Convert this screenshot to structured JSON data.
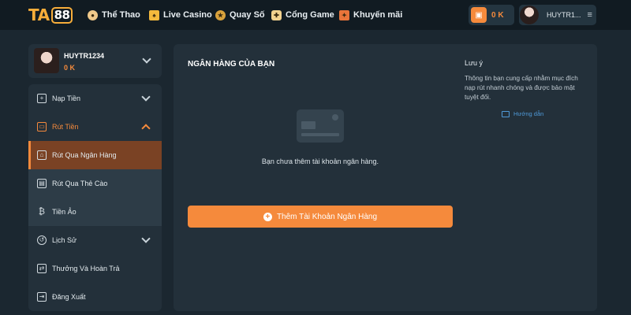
{
  "header": {
    "logo_text": "TA",
    "logo_badge": "88",
    "nav": [
      {
        "label": "Thể Thao",
        "icon": "ball-icon"
      },
      {
        "label": "Live Casino",
        "icon": "cards-icon"
      },
      {
        "label": "Quay Số",
        "icon": "lottery-icon"
      },
      {
        "label": "Cổng Game",
        "icon": "gamepad-icon"
      },
      {
        "label": "Khuyến mãi",
        "icon": "gift-icon"
      }
    ],
    "balance": "0 K",
    "username": "HUYTR1...",
    "menu_glyph": "≡"
  },
  "sidebar": {
    "profile": {
      "name": "HUYTR1234",
      "balance": "0 K"
    },
    "items": [
      {
        "label": "Nạp Tiền",
        "icon": "deposit-icon",
        "glyph": "+"
      },
      {
        "label": "Rút Tiền",
        "icon": "withdraw-icon",
        "glyph": "▭"
      },
      {
        "label": "Rút Qua Ngân Hàng",
        "icon": "bank-icon",
        "glyph": "⌂"
      },
      {
        "label": "Rút Qua Thẻ Cào",
        "icon": "card-icon",
        "glyph": "▤"
      },
      {
        "label": "Tiền Ảo",
        "icon": "bitcoin-icon",
        "glyph": "₿"
      },
      {
        "label": "Lịch Sử",
        "icon": "history-icon",
        "glyph": "↺"
      },
      {
        "label": "Thưởng Và Hoàn Trả",
        "icon": "reward-icon",
        "glyph": "⇄"
      },
      {
        "label": "Đăng Xuất",
        "icon": "logout-icon",
        "glyph": "⇥"
      }
    ]
  },
  "main": {
    "title": "NGÂN HÀNG CỦA BẠN",
    "empty_message": "Bạn chưa thêm tài khoản ngân hàng.",
    "add_button": "Thêm Tài Khoản Ngân Hàng",
    "note": {
      "title": "Lưu ý",
      "text": "Thông tin bạn cung cấp nhằm mục đích nạp rút nhanh chóng và được bảo mật tuyệt đối.",
      "guide_link": "Hướng dẫn"
    }
  },
  "colors": {
    "accent": "#f58a3c",
    "background": "#1b2730",
    "card": "#23303a",
    "link": "#4f9ad8"
  }
}
